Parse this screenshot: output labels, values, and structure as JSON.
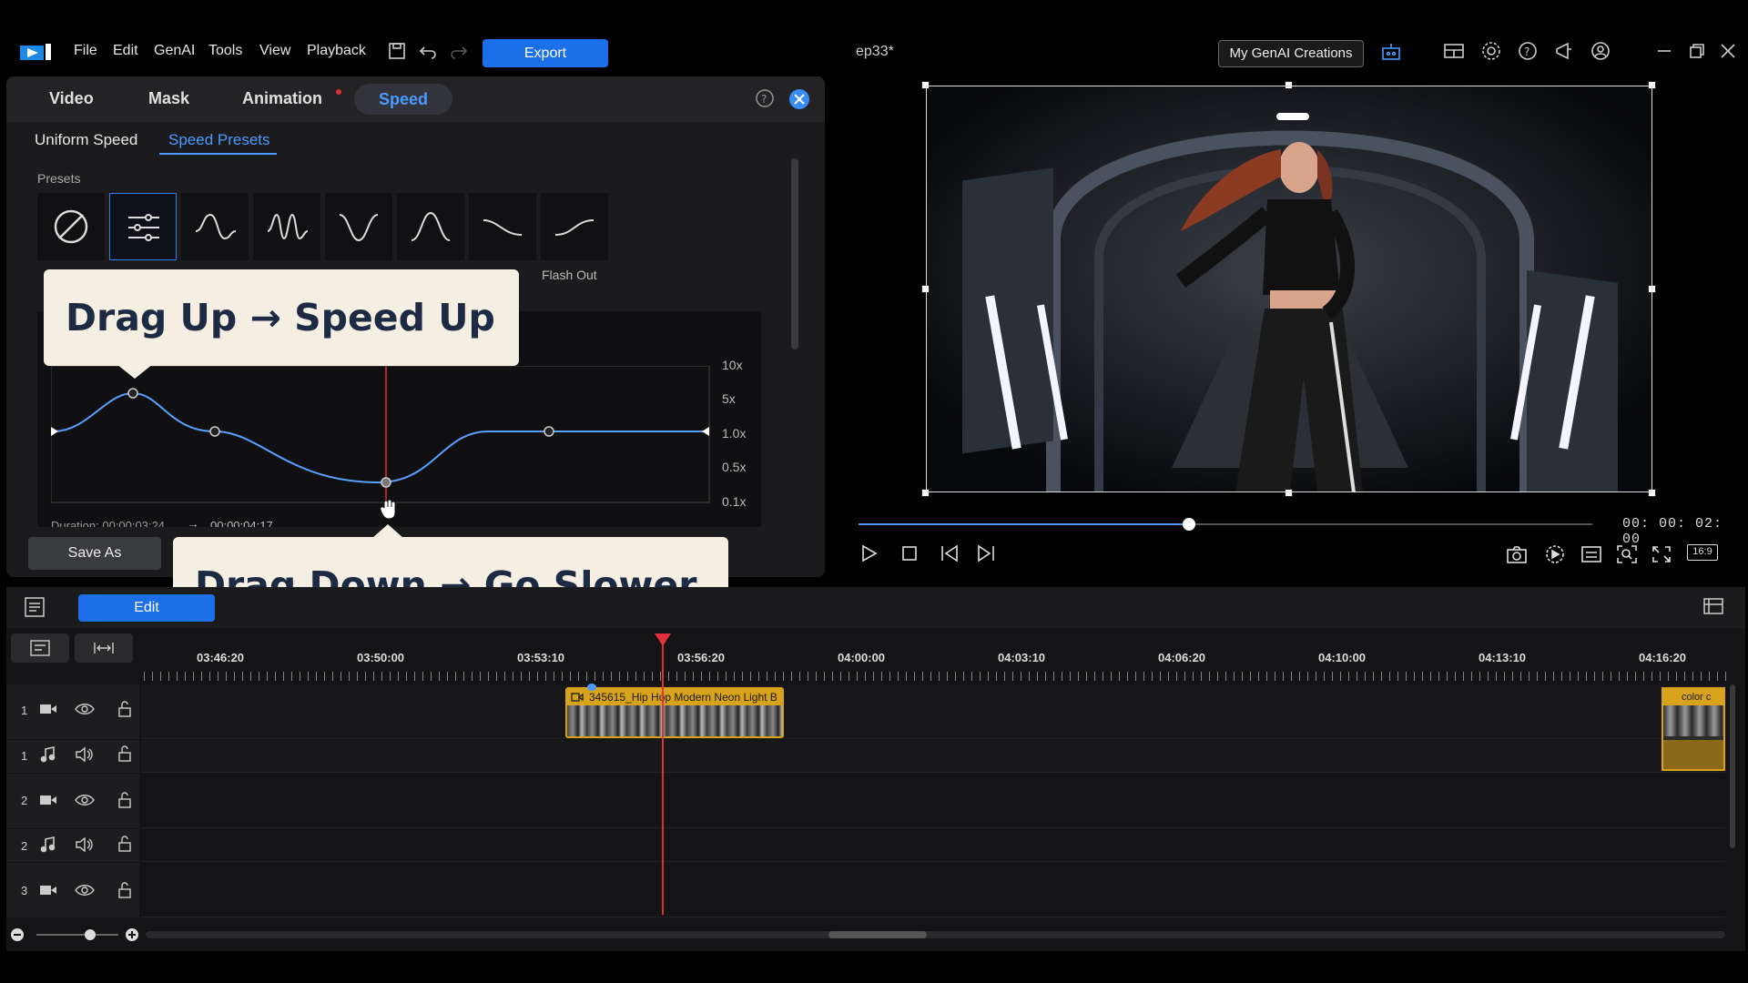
{
  "menu": [
    "File",
    "Edit",
    "GenAI",
    "Tools",
    "View",
    "Playback"
  ],
  "toolbar": {
    "export_label": "Export"
  },
  "project_title": "ep33*",
  "genai_button": "My GenAI Creations",
  "panel": {
    "tabs": [
      "Video",
      "Mask",
      "Animation",
      "Speed"
    ],
    "active_tab": "Speed",
    "subtabs": [
      "Uniform Speed",
      "Speed Presets"
    ],
    "active_subtab": "Speed Presets",
    "presets_label": "Presets",
    "flash_out_label": "Flash Out",
    "y_labels": [
      "10x",
      "5x",
      "1.0x",
      "0.5x",
      "0.1x"
    ],
    "duration_text": "Duration: 00:00:03:24",
    "new_duration_text": "00:00:04:17",
    "save_as_label": "Save As"
  },
  "callouts": {
    "up": "Drag Up → Speed Up",
    "down": "Drag Down → Go Slower"
  },
  "preview": {
    "timecode": "00: 00: 02: 00",
    "progress": 0.45,
    "aspect": "16:9"
  },
  "timeline": {
    "edit_label": "Edit",
    "ruler": [
      "03:46:20",
      "03:50:00",
      "03:53:10",
      "03:56:20",
      "04:00:00",
      "04:03:10",
      "04:06:20",
      "04:10:00",
      "04:13:10",
      "04:16:20"
    ],
    "tracks": [
      {
        "num": "1",
        "type": "video"
      },
      {
        "num": "1",
        "type": "audio"
      },
      {
        "num": "2",
        "type": "video"
      },
      {
        "num": "2",
        "type": "audio"
      },
      {
        "num": "3",
        "type": "video"
      }
    ],
    "clip_title": "345615_Hip Hop Modern Neon Light B",
    "clip2_title": "color c"
  },
  "colors": {
    "accent": "#1b6fe8",
    "clip": "#d8a21a",
    "playhead": "#e0303a"
  }
}
